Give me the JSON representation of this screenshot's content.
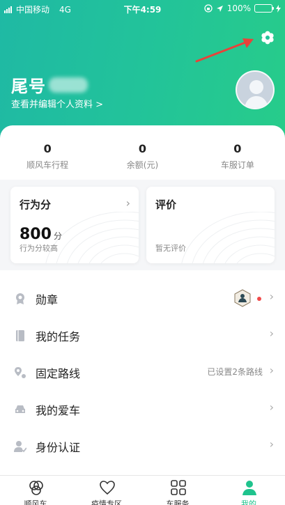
{
  "status_bar": {
    "carrier": "中国移动",
    "network": "4G",
    "time": "下午4:59",
    "battery": "100%"
  },
  "profile": {
    "name_prefix": "尾号",
    "edit_link": "查看并编辑个人资料 >"
  },
  "stats": [
    {
      "value": "0",
      "label": "顺风车行程"
    },
    {
      "value": "0",
      "label": "余额(元)"
    },
    {
      "value": "0",
      "label": "车服订单"
    }
  ],
  "cards": {
    "behavior": {
      "title": "行为分",
      "score": "800",
      "unit": "分",
      "sub": "行为分较高"
    },
    "review": {
      "title": "评价",
      "sub": "暂无评价"
    }
  },
  "menu": [
    {
      "label": "勋章",
      "right": ""
    },
    {
      "label": "我的任务",
      "right": ""
    },
    {
      "label": "固定路线",
      "right": "已设置2条路线"
    },
    {
      "label": "我的爱车",
      "right": ""
    },
    {
      "label": "身份认证",
      "right": ""
    }
  ],
  "tabs": [
    {
      "label": "顺风车"
    },
    {
      "label": "疫情专区"
    },
    {
      "label": "车服务"
    },
    {
      "label": "我的"
    }
  ],
  "colors": {
    "accent": "#1fc38d",
    "header_start": "#1fb9a4",
    "header_end": "#27cc8a",
    "annotation_arrow": "#e8433a"
  },
  "icons": {
    "settings": "gear-icon",
    "chevron": "chevron-right-icon"
  }
}
